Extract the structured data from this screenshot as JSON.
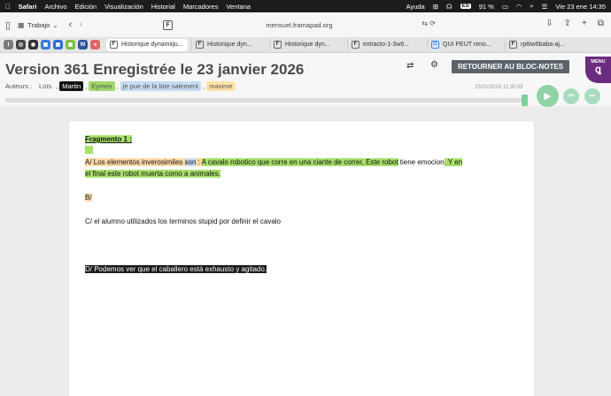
{
  "menubar": {
    "apple": "",
    "items": [
      "Safari",
      "Archivo",
      "Edición",
      "Visualización",
      "Historial",
      "Marcadores",
      "Ventana"
    ],
    "right": {
      "help": "Ayuda",
      "battery": "91 %",
      "lang": "ES",
      "datetime": "Vie 23 ene 14:35"
    }
  },
  "toolbar": {
    "tab_group": "Trabajo",
    "url": "mensuel.framapad.org"
  },
  "tabs": [
    {
      "label": "Historique dynamiqu...",
      "active": true,
      "icon": "F"
    },
    {
      "label": "Historique dyn...",
      "active": false,
      "icon": "F"
    },
    {
      "label": "Historique dyn...",
      "active": false,
      "icon": "F"
    },
    {
      "label": "extracto-1-3w6...",
      "active": false,
      "icon": "F"
    },
    {
      "label": "QUI PEUT reno...",
      "active": false,
      "icon": "G"
    },
    {
      "label": "rp6iw6baba-aj...",
      "active": false,
      "icon": "F"
    }
  ],
  "pinned": [
    {
      "label": "I",
      "color": "#7b7b7b"
    },
    {
      "label": "◎",
      "color": "#444444"
    },
    {
      "label": "◉",
      "color": "#333333"
    },
    {
      "label": "▣",
      "color": "#3a7bd5"
    },
    {
      "label": "▣",
      "color": "#2f6fcf"
    },
    {
      "label": "▣",
      "color": "#7ac143"
    },
    {
      "label": "W",
      "color": "#2b579a"
    },
    {
      "label": "●",
      "color": "#e06666"
    }
  ],
  "header": {
    "title": "Version 361 Enregistrée le 23 janvier 2026",
    "authors_label": "Auteurs :",
    "authors": [
      {
        "name": "Loïs",
        "bg": "transparent",
        "fg": "#333333"
      },
      {
        "name": "Martin",
        "bg": "#111111",
        "fg": "#ffffff"
      },
      {
        "name": "Eymen",
        "bg": "#9fd86b",
        "fg": "#222222"
      },
      {
        "name": "je pue de la bite salement",
        "bg": "#c4dcf3",
        "fg": "#333333"
      },
      {
        "name": "maxime",
        "bg": "#ffe3a8",
        "fg": "#333333"
      }
    ],
    "back_button": "RETOURNER AU BLOC-NOTES",
    "menu_label": "MENU",
    "version_date": "23/01/2026 11:30:59",
    "slider_position": 1.0
  },
  "document": {
    "fragment_title": "Fragmento 1 :",
    "line_a": {
      "parts": [
        {
          "text": "A/ Los elementos inverosimiles ",
          "hl": "peach"
        },
        {
          "text": "son",
          "hl": "blue"
        },
        {
          "text": " : ",
          "hl": "peach"
        },
        {
          "text": "A cavalo robotico que corre en una ciante de correr, Este robot",
          "hl": "green"
        },
        {
          "text": " tiene emocion",
          "hl": "none"
        },
        {
          "text": ". Y en",
          "hl": "green"
        }
      ],
      "continuation": "el final este robot muerta como a animales."
    },
    "line_b": "B/",
    "line_c": "C/ el alumno utilizados los terminos stupid por definir el cavalo",
    "line_d": "D/ Podemos ver que el caballero está exhausto y agitado."
  }
}
